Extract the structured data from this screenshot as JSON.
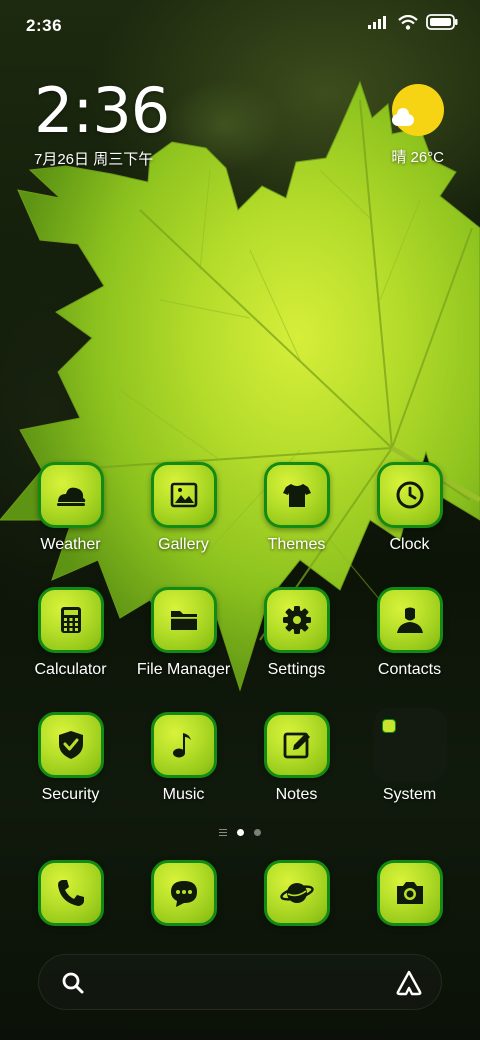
{
  "status_bar": {
    "time": "2:36"
  },
  "clock_widget": {
    "time": "2:36",
    "date": "7月26日 周三下午"
  },
  "weather_widget": {
    "condition_temp": "晴 26°C",
    "icon": "sunny-cloud-icon",
    "sun_color": "#f6d413"
  },
  "colors": {
    "icon_border": "#138a14",
    "icon_fill": "#b8e02a"
  },
  "apps": [
    {
      "label": "Weather",
      "icon": "weather-icon"
    },
    {
      "label": "Gallery",
      "icon": "gallery-icon"
    },
    {
      "label": "Themes",
      "icon": "themes-icon"
    },
    {
      "label": "Clock",
      "icon": "clock-icon"
    },
    {
      "label": "Calculator",
      "icon": "calculator-icon"
    },
    {
      "label": "File Manager",
      "icon": "folder-icon"
    },
    {
      "label": "Settings",
      "icon": "gear-icon"
    },
    {
      "label": "Contacts",
      "icon": "contacts-icon"
    },
    {
      "label": "Security",
      "icon": "shield-icon"
    },
    {
      "label": "Music",
      "icon": "music-note-icon"
    },
    {
      "label": "Notes",
      "icon": "notes-icon"
    },
    {
      "label": "System",
      "icon": "folder-icon"
    }
  ],
  "dock": [
    {
      "icon": "phone-icon"
    },
    {
      "icon": "message-icon"
    },
    {
      "icon": "browser-planet-icon"
    },
    {
      "icon": "camera-icon"
    }
  ],
  "pages": {
    "count": 2,
    "active": 1
  }
}
